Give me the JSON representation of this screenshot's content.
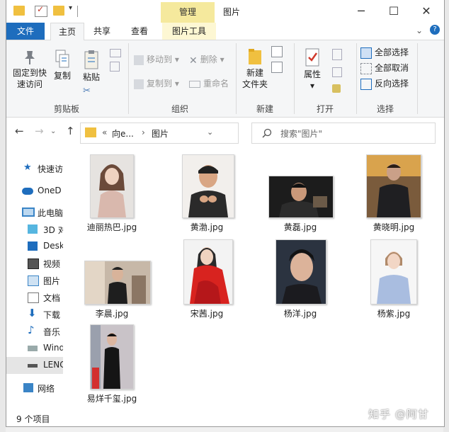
{
  "titlebar": {
    "manage_tab": "管理",
    "title": "图片",
    "minimize": "─",
    "maximize": "☐",
    "close": "✕"
  },
  "tabs": {
    "file": "文件",
    "home": "主页",
    "share": "共享",
    "view": "查看",
    "picture_tools": "图片工具"
  },
  "ribbon": {
    "clipboard": {
      "label": "剪贴板",
      "pin_line1": "固定到快",
      "pin_line2": "速访问",
      "copy": "复制",
      "paste": "粘贴"
    },
    "organize": {
      "label": "组织",
      "move_to": "移动到",
      "copy_to": "复制到",
      "delete": "删除",
      "rename": "重命名"
    },
    "new": {
      "label": "新建",
      "new_folder_line1": "新建",
      "new_folder_line2": "文件夹"
    },
    "open": {
      "label": "打开",
      "properties": "属性"
    },
    "select": {
      "label": "选择",
      "select_all": "全部选择",
      "select_none": "全部取消",
      "invert": "反向选择"
    }
  },
  "address": {
    "chevrons": "«",
    "parent": "向e...",
    "sep": "›",
    "current": "图片",
    "search_placeholder": "搜索\"图片\""
  },
  "nav_pane": [
    {
      "label": "快速访",
      "icon": "star-icon"
    },
    {
      "label": "OneD",
      "icon": "cloud-icon"
    },
    {
      "label": "此电脑",
      "icon": "computer-icon"
    },
    {
      "label": "3D 对",
      "icon": "cube-icon"
    },
    {
      "label": "Desk",
      "icon": "desktop-icon"
    },
    {
      "label": "视频",
      "icon": "video-icon"
    },
    {
      "label": "图片",
      "icon": "pictures-icon"
    },
    {
      "label": "文档",
      "icon": "documents-icon"
    },
    {
      "label": "下载",
      "icon": "download-icon"
    },
    {
      "label": "音乐",
      "icon": "music-icon"
    },
    {
      "label": "Wind",
      "icon": "drive-icon"
    },
    {
      "label": "LENC",
      "icon": "drive-icon"
    },
    {
      "label": "网络",
      "icon": "network-icon"
    }
  ],
  "files": [
    {
      "name": "迪丽热巴.jpg"
    },
    {
      "name": "黄渤.jpg"
    },
    {
      "name": "黄磊.jpg"
    },
    {
      "name": "黄晓明.jpg"
    },
    {
      "name": "李晨.jpg"
    },
    {
      "name": "宋茜.jpg"
    },
    {
      "name": "杨洋.jpg"
    },
    {
      "name": "杨紫.jpg"
    },
    {
      "name": "易烊千玺.jpg"
    }
  ],
  "status": {
    "count": "9 个项目"
  },
  "watermark": "知乎 @阿甘"
}
